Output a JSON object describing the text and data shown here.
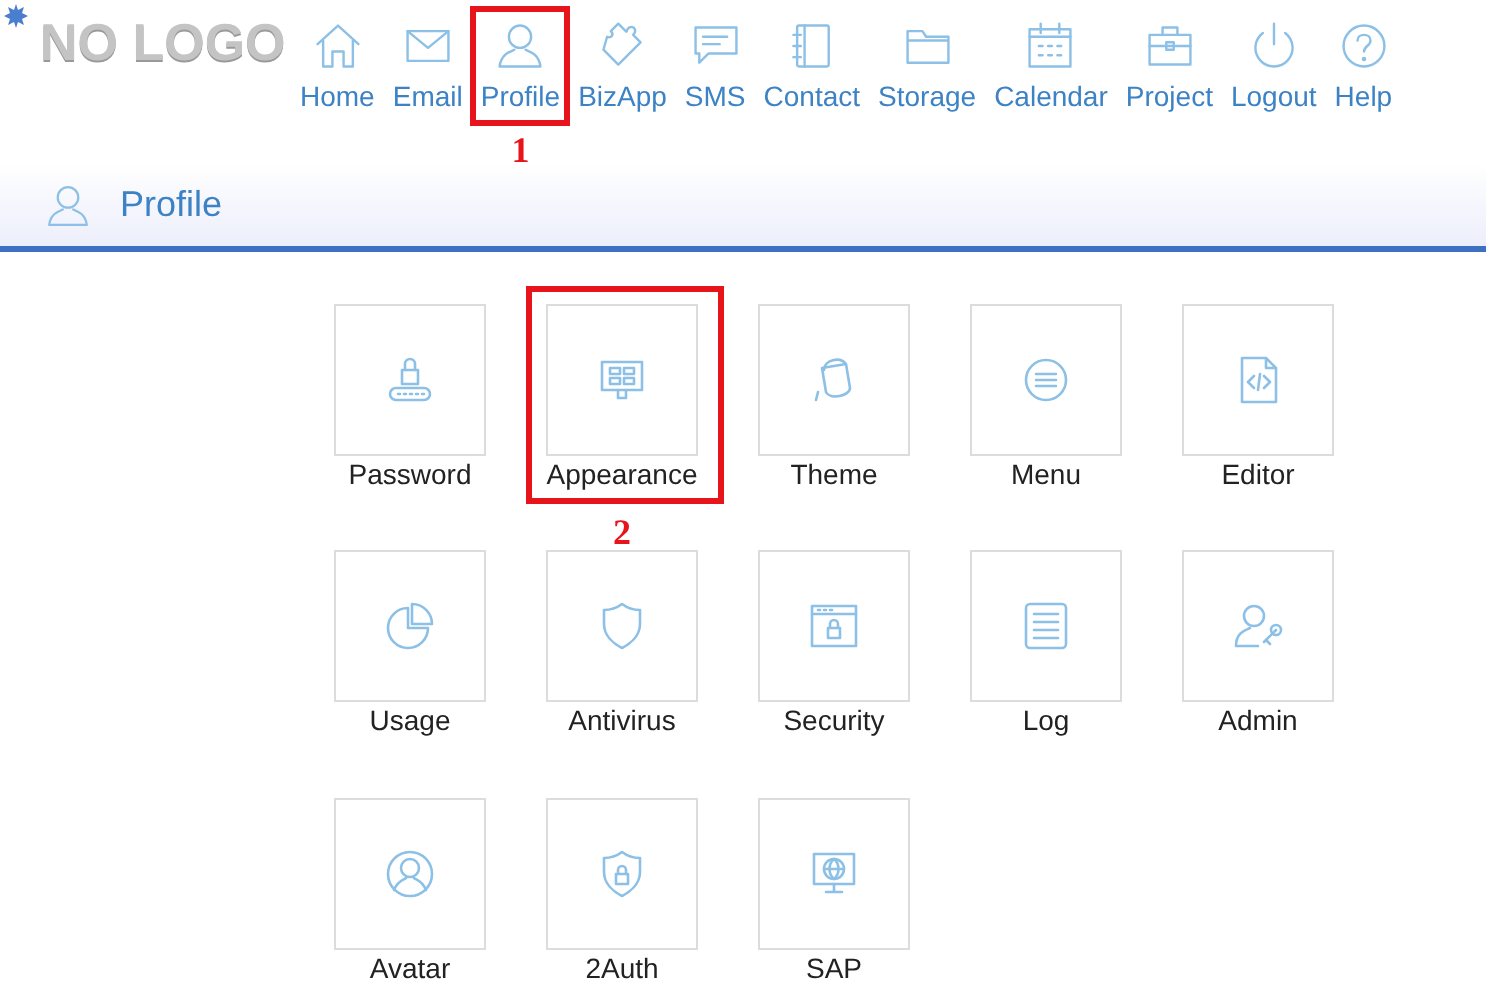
{
  "logo": "NO LOGO",
  "nav": [
    {
      "label": "Home"
    },
    {
      "label": "Email"
    },
    {
      "label": "Profile",
      "callout": "1"
    },
    {
      "label": "BizApp"
    },
    {
      "label": "SMS"
    },
    {
      "label": "Contact"
    },
    {
      "label": "Storage"
    },
    {
      "label": "Calendar"
    },
    {
      "label": "Project"
    },
    {
      "label": "Logout"
    },
    {
      "label": "Help"
    }
  ],
  "page_title": "Profile",
  "tiles": [
    {
      "label": "Password"
    },
    {
      "label": "Appearance",
      "callout": "2"
    },
    {
      "label": "Theme"
    },
    {
      "label": "Menu"
    },
    {
      "label": "Editor"
    },
    {
      "label": "Usage"
    },
    {
      "label": "Antivirus"
    },
    {
      "label": "Security"
    },
    {
      "label": "Log"
    },
    {
      "label": "Admin"
    },
    {
      "label": "Avatar"
    },
    {
      "label": "2Auth"
    },
    {
      "label": "SAP"
    }
  ]
}
